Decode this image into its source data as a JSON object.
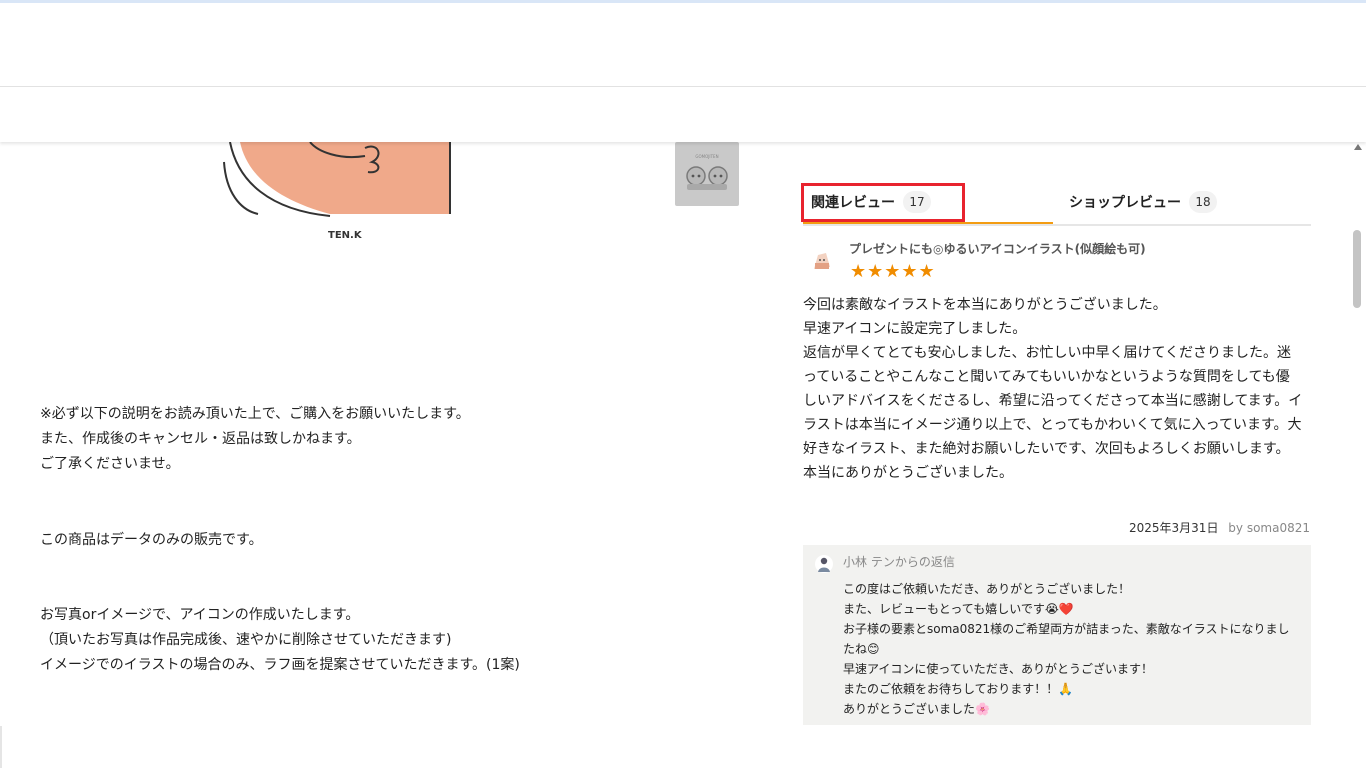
{
  "product": {
    "image_signature": "TEN.K",
    "thumbnail_logo": "GOMOJITEN"
  },
  "description": {
    "lines_1": [
      "※必ず以下の説明をお読み頂いた上で、ご購入をお願いいたします。",
      "また、作成後のキャンセル・返品は致しかねます。",
      "ご了承くださいませ。"
    ],
    "lines_2": [
      "この商品はデータのみの販売です。"
    ],
    "lines_3": [
      "お写真orイメージで、アイコンの作成いたします。",
      "（頂いたお写真は作品完成後、速やかに削除させていただきます)",
      "イメージでのイラストの場合のみ、ラフ画を提案させていただきます。(1案)"
    ]
  },
  "tabs": {
    "related_label": "関連レビュー",
    "related_count": "17",
    "shop_label": "ショップレビュー",
    "shop_count": "18"
  },
  "review": {
    "title": "プレゼントにも◎ゆるいアイコンイラスト(似顔絵も可)",
    "stars": "★★★★★",
    "rating": 5,
    "body": [
      "今回は素敵なイラストを本当にありがとうございました。",
      "早速アイコンに設定完了しました。",
      "返信が早くてとても安心しました、お忙しい中早く届けてくださりました。迷っていることやこんなこと聞いてみてもいいかなというような質問をしても優しいアドバイスをくださるし、希望に沿ってくださって本当に感謝してます。イラストは本当にイメージ通り以上で、とってもかわいくて気に入っています。大好きなイラスト、また絶対お願いしたいです、次回もよろしくお願いします。",
      "本当にありがとうございました。"
    ],
    "date": "2025年3月31日",
    "by": "by soma0821"
  },
  "reply": {
    "from": "小林 テンからの返信",
    "body": [
      "この度はご依頼いただき、ありがとうございました！",
      "また、レビューもとっても嬉しいです😭❤️",
      "お子様の要素とsoma0821様のご希望両方が詰まった、素敵なイラストになりましたね😊",
      "早速アイコンに使っていただき、ありがとうございます！",
      "またのご依頼をお待ちしております！！🙏",
      "ありがとうございました🌸"
    ]
  },
  "colors": {
    "accent_orange": "#f39c12",
    "star_orange": "#f08c00",
    "highlight_red": "#e8232e",
    "reply_bg": "#f2f2f0"
  }
}
